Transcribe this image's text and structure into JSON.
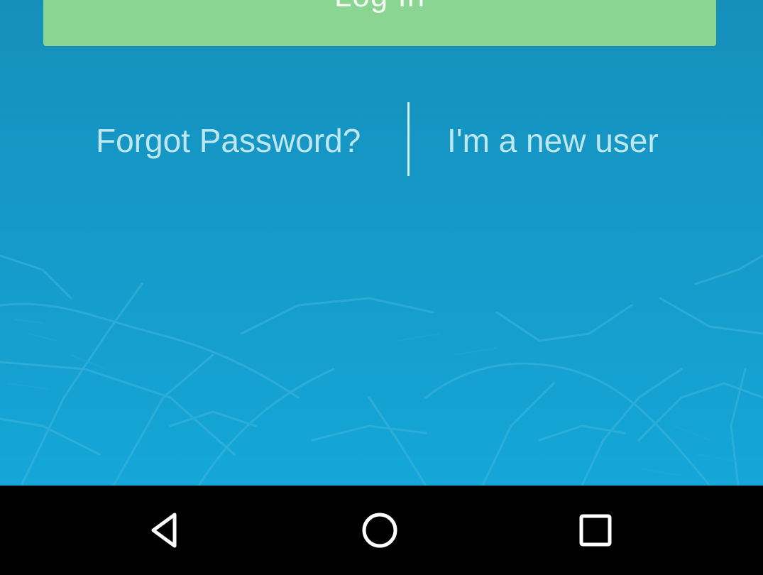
{
  "login": {
    "button_label": "Log In"
  },
  "links": {
    "forgot_password": "Forgot Password?",
    "new_user": "I'm a new user"
  },
  "navigation_bar": {
    "back_icon": "back-triangle-icon",
    "home_icon": "home-circle-icon",
    "recents_icon": "recents-square-icon"
  },
  "colors": {
    "background_top": "#168fbb",
    "background_bottom": "#14a7d8",
    "login_button": "#89d591",
    "link_text": "#bfe7ef",
    "nav_bar": "#000000"
  }
}
